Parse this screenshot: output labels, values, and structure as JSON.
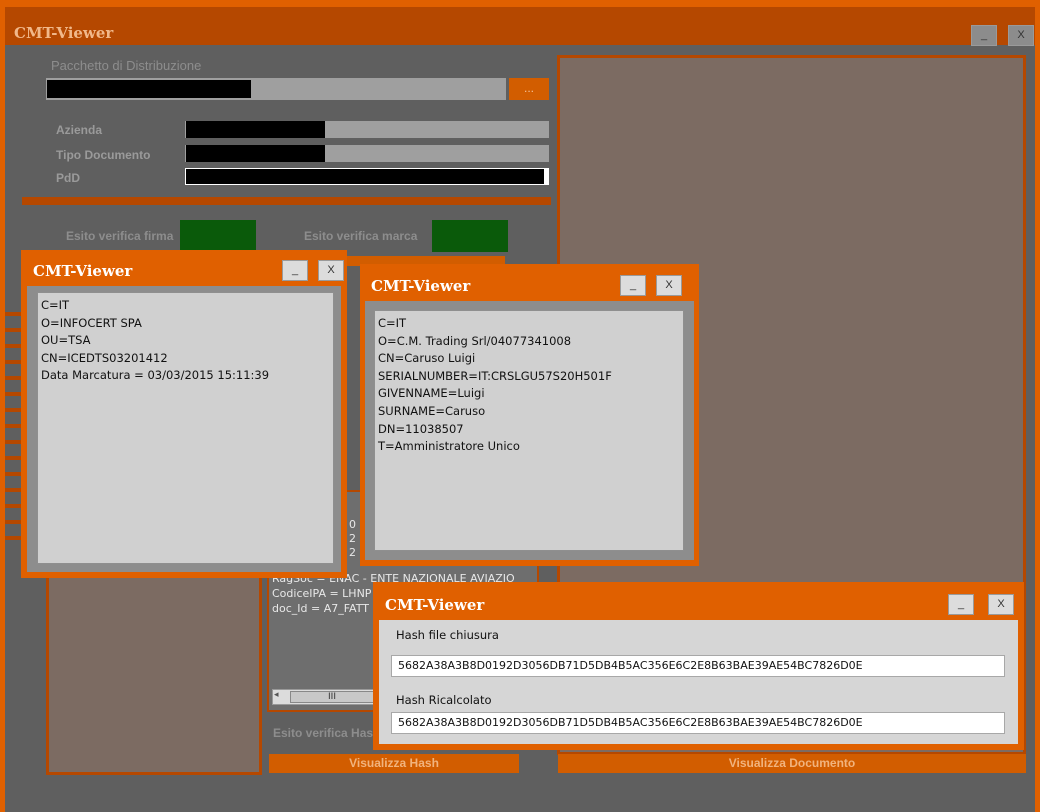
{
  "main": {
    "title": "CMT-Viewer",
    "minimize": "_",
    "close": "X",
    "package_label": "Pacchetto di Distribuzione",
    "browse_label": "...",
    "azienda_label": "Azienda",
    "tipo_label": "Tipo Documento",
    "pdd_label": "PdD",
    "esito_firma_label": "Esito verifica firma",
    "esito_marca_label": "Esito verifica marca",
    "esito_hash_label": "Esito verifica Has",
    "visualizza_hash": "Visualizza Hash",
    "visualizza_documento": "Visualizza Documento",
    "bg_text": {
      "line1": "RagSoc = ENAC - ENTE NAZIONALE AVIAZIO",
      "line2": "CodiceIPA = LHNP",
      "line3": "doc_Id = A7_FATT",
      "frag1": "0",
      "frag2": "2",
      "frag3": "2",
      "scroll_thumb": "III"
    }
  },
  "popup_marca": {
    "title": "CMT-Viewer",
    "minimize": "_",
    "close": "X",
    "lines": [
      "C=IT",
      "O=INFOCERT SPA",
      "OU=TSA",
      "CN=ICEDTS03201412",
      "Data Marcatura = 03/03/2015 15:11:39"
    ]
  },
  "popup_firma": {
    "title": "CMT-Viewer",
    "minimize": "_",
    "close": "X",
    "lines": [
      "C=IT",
      "O=C.M. Trading Srl/04077341008",
      "CN=Caruso Luigi",
      "SERIALNUMBER=IT:CRSLGU57S20H501F",
      "GIVENNAME=Luigi",
      "SURNAME=Caruso",
      "DN=11038507",
      "T=Amministratore Unico"
    ]
  },
  "popup_hash": {
    "title": "CMT-Viewer",
    "minimize": "_",
    "close": "X",
    "hash_chiusura_label": "Hash file chiusura",
    "hash_chiusura_value": "5682A38A3B8D0192D3056DB71D5DB4B5AC356E6C2E8B63BAE39AE54BC7826D0E",
    "hash_ricalcolato_label": "Hash Ricalcolato",
    "hash_ricalcolato_value": "5682A38A3B8D0192D3056DB71D5DB4B5AC356E6C2E8B63BAE39AE54BC7826D0E"
  },
  "colors": {
    "orange": "#e06000",
    "dark_orange": "#b54800",
    "panel_bg": "#5f5f5f",
    "preview_bg": "#7c6b62",
    "status_green": "#0a5a0a"
  }
}
